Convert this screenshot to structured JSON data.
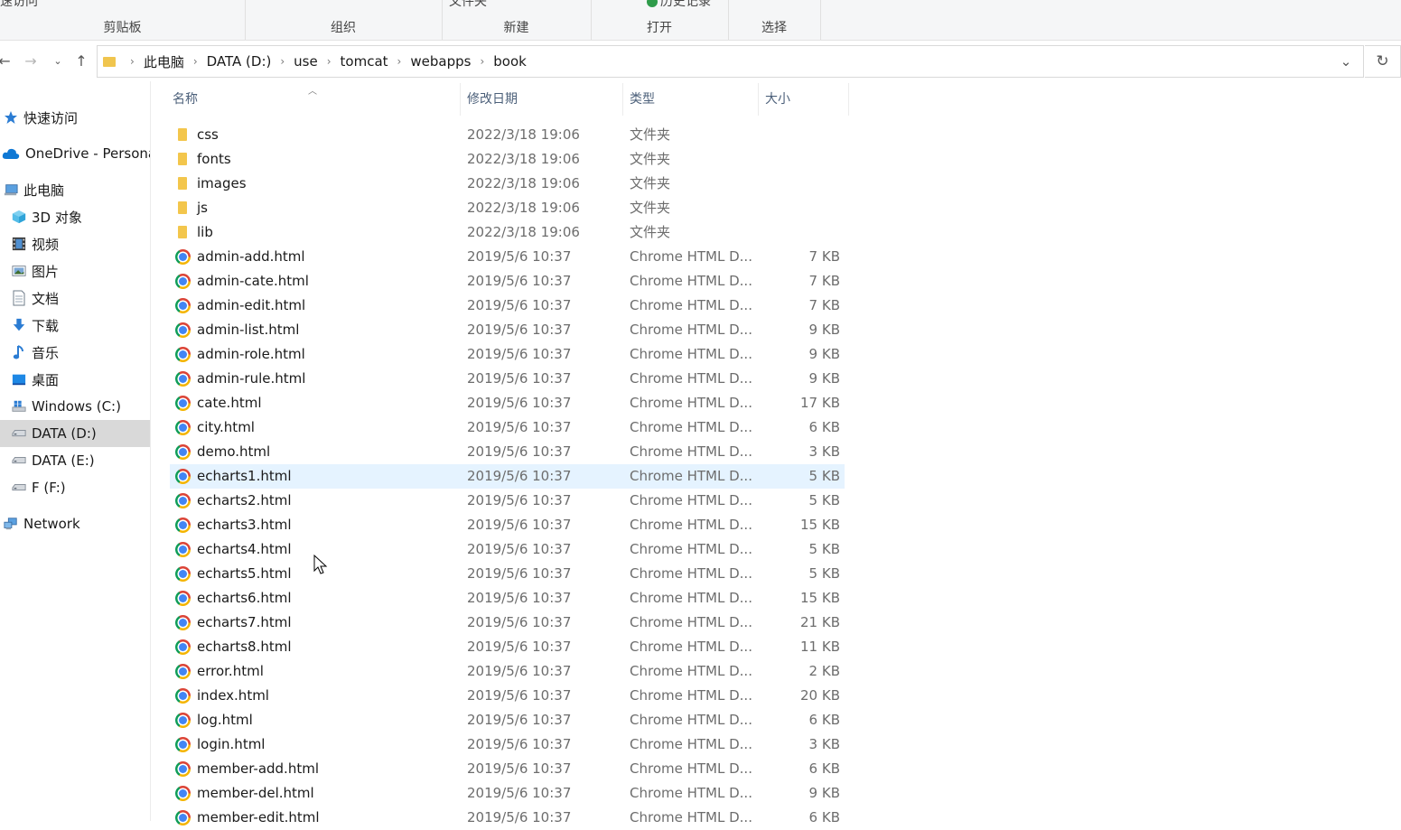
{
  "ribbon": {
    "groups": [
      "剪贴板",
      "组织",
      "新建",
      "打开",
      "选择"
    ],
    "top_partial": {
      "quick_access": "速访问",
      "new_folder": "文件夹",
      "history": "历史记录"
    }
  },
  "nav": {
    "back_icon": "back-arrow-icon",
    "forward_icon": "forward-arrow-icon",
    "up_icon": "up-arrow-icon"
  },
  "address": {
    "crumbs": [
      "此电脑",
      "DATA (D:)",
      "use",
      "tomcat",
      "webapps",
      "book"
    ]
  },
  "sidebar": {
    "items": [
      {
        "label": "快速访问",
        "icon": "star-icon"
      },
      {
        "label": "OneDrive - Persona",
        "icon": "cloud-icon"
      },
      {
        "label": "此电脑",
        "icon": "computer-icon"
      },
      {
        "label": "3D 对象",
        "icon": "cube-icon"
      },
      {
        "label": "视频",
        "icon": "film-icon"
      },
      {
        "label": "图片",
        "icon": "picture-icon"
      },
      {
        "label": "文档",
        "icon": "document-icon"
      },
      {
        "label": "下载",
        "icon": "download-icon"
      },
      {
        "label": "音乐",
        "icon": "music-icon"
      },
      {
        "label": "桌面",
        "icon": "desktop-icon"
      },
      {
        "label": "Windows (C:)",
        "icon": "windows-drive-icon"
      },
      {
        "label": "DATA (D:)",
        "icon": "drive-icon"
      },
      {
        "label": "DATA (E:)",
        "icon": "drive-icon"
      },
      {
        "label": "F (F:)",
        "icon": "drive-icon"
      },
      {
        "label": "Network",
        "icon": "network-icon"
      }
    ],
    "selected": "DATA (D:)"
  },
  "columns": {
    "name": "名称",
    "date": "修改日期",
    "type": "类型",
    "size": "大小"
  },
  "files": [
    {
      "name": "css",
      "date": "2022/3/18 19:06",
      "type": "文件夹",
      "size": "",
      "kind": "folder"
    },
    {
      "name": "fonts",
      "date": "2022/3/18 19:06",
      "type": "文件夹",
      "size": "",
      "kind": "folder"
    },
    {
      "name": "images",
      "date": "2022/3/18 19:06",
      "type": "文件夹",
      "size": "",
      "kind": "folder"
    },
    {
      "name": "js",
      "date": "2022/3/18 19:06",
      "type": "文件夹",
      "size": "",
      "kind": "folder"
    },
    {
      "name": "lib",
      "date": "2022/3/18 19:06",
      "type": "文件夹",
      "size": "",
      "kind": "folder"
    },
    {
      "name": "admin-add.html",
      "date": "2019/5/6 10:37",
      "type": "Chrome HTML D...",
      "size": "7 KB",
      "kind": "chrome"
    },
    {
      "name": "admin-cate.html",
      "date": "2019/5/6 10:37",
      "type": "Chrome HTML D...",
      "size": "7 KB",
      "kind": "chrome"
    },
    {
      "name": "admin-edit.html",
      "date": "2019/5/6 10:37",
      "type": "Chrome HTML D...",
      "size": "7 KB",
      "kind": "chrome"
    },
    {
      "name": "admin-list.html",
      "date": "2019/5/6 10:37",
      "type": "Chrome HTML D...",
      "size": "9 KB",
      "kind": "chrome"
    },
    {
      "name": "admin-role.html",
      "date": "2019/5/6 10:37",
      "type": "Chrome HTML D...",
      "size": "9 KB",
      "kind": "chrome"
    },
    {
      "name": "admin-rule.html",
      "date": "2019/5/6 10:37",
      "type": "Chrome HTML D...",
      "size": "9 KB",
      "kind": "chrome"
    },
    {
      "name": "cate.html",
      "date": "2019/5/6 10:37",
      "type": "Chrome HTML D...",
      "size": "17 KB",
      "kind": "chrome"
    },
    {
      "name": "city.html",
      "date": "2019/5/6 10:37",
      "type": "Chrome HTML D...",
      "size": "6 KB",
      "kind": "chrome"
    },
    {
      "name": "demo.html",
      "date": "2019/5/6 10:37",
      "type": "Chrome HTML D...",
      "size": "3 KB",
      "kind": "chrome"
    },
    {
      "name": "echarts1.html",
      "date": "2019/5/6 10:37",
      "type": "Chrome HTML D...",
      "size": "5 KB",
      "kind": "chrome",
      "hover": true
    },
    {
      "name": "echarts2.html",
      "date": "2019/5/6 10:37",
      "type": "Chrome HTML D...",
      "size": "5 KB",
      "kind": "chrome"
    },
    {
      "name": "echarts3.html",
      "date": "2019/5/6 10:37",
      "type": "Chrome HTML D...",
      "size": "15 KB",
      "kind": "chrome"
    },
    {
      "name": "echarts4.html",
      "date": "2019/5/6 10:37",
      "type": "Chrome HTML D...",
      "size": "5 KB",
      "kind": "chrome"
    },
    {
      "name": "echarts5.html",
      "date": "2019/5/6 10:37",
      "type": "Chrome HTML D...",
      "size": "5 KB",
      "kind": "chrome"
    },
    {
      "name": "echarts6.html",
      "date": "2019/5/6 10:37",
      "type": "Chrome HTML D...",
      "size": "15 KB",
      "kind": "chrome"
    },
    {
      "name": "echarts7.html",
      "date": "2019/5/6 10:37",
      "type": "Chrome HTML D...",
      "size": "21 KB",
      "kind": "chrome"
    },
    {
      "name": "echarts8.html",
      "date": "2019/5/6 10:37",
      "type": "Chrome HTML D...",
      "size": "11 KB",
      "kind": "chrome"
    },
    {
      "name": "error.html",
      "date": "2019/5/6 10:37",
      "type": "Chrome HTML D...",
      "size": "2 KB",
      "kind": "chrome"
    },
    {
      "name": "index.html",
      "date": "2019/5/6 10:37",
      "type": "Chrome HTML D...",
      "size": "20 KB",
      "kind": "chrome"
    },
    {
      "name": "log.html",
      "date": "2019/5/6 10:37",
      "type": "Chrome HTML D...",
      "size": "6 KB",
      "kind": "chrome"
    },
    {
      "name": "login.html",
      "date": "2019/5/6 10:37",
      "type": "Chrome HTML D...",
      "size": "3 KB",
      "kind": "chrome"
    },
    {
      "name": "member-add.html",
      "date": "2019/5/6 10:37",
      "type": "Chrome HTML D...",
      "size": "6 KB",
      "kind": "chrome"
    },
    {
      "name": "member-del.html",
      "date": "2019/5/6 10:37",
      "type": "Chrome HTML D...",
      "size": "9 KB",
      "kind": "chrome"
    },
    {
      "name": "member-edit.html",
      "date": "2019/5/6 10:37",
      "type": "Chrome HTML D...",
      "size": "6 KB",
      "kind": "chrome"
    }
  ],
  "colors": {
    "hover_row": "#e5f3ff",
    "selected_nav": "#d9d9d9",
    "folder": "#f3c64c",
    "header_text": "#4c607a"
  }
}
